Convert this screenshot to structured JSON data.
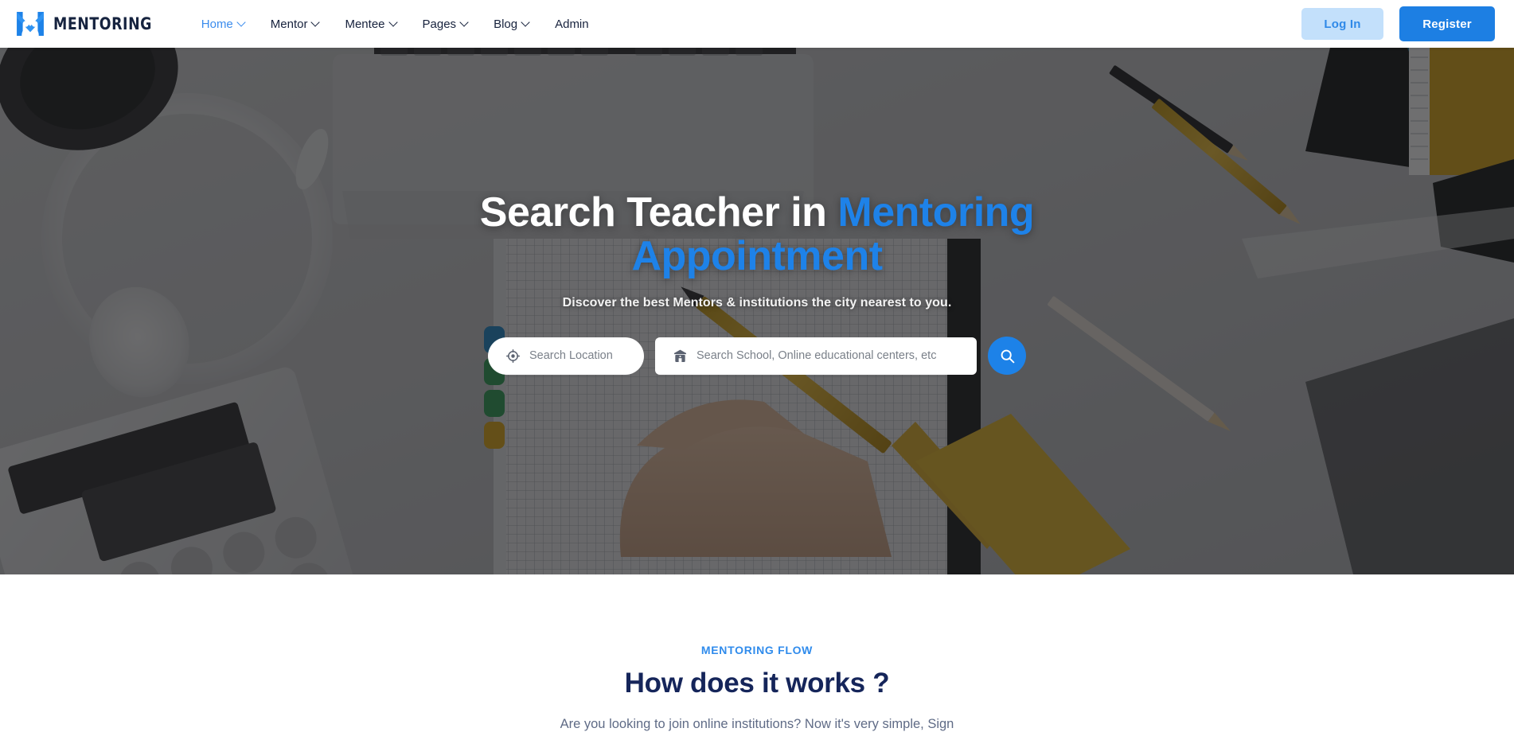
{
  "brand": {
    "name": "MENTORING",
    "logo_icon": "mentoring-m-people-logo",
    "accent_color": "#1d82e8",
    "text_color": "#16233f"
  },
  "nav": {
    "items": [
      {
        "label": "Home",
        "has_dropdown": true,
        "active": true
      },
      {
        "label": "Mentor",
        "has_dropdown": true,
        "active": false
      },
      {
        "label": "Mentee",
        "has_dropdown": true,
        "active": false
      },
      {
        "label": "Pages",
        "has_dropdown": true,
        "active": false
      },
      {
        "label": "Blog",
        "has_dropdown": true,
        "active": false
      },
      {
        "label": "Admin",
        "has_dropdown": false,
        "active": false
      }
    ],
    "login_label": "Log In",
    "register_label": "Register",
    "login_bg": "#c3e0fb",
    "login_fg": "#2f89e8",
    "register_bg": "#1d7fe3",
    "register_fg": "#ffffff"
  },
  "hero": {
    "title_part1": "Search Teacher in ",
    "title_accent": "Mentoring Appointment",
    "subtitle": "Discover the best Mentors & institutions the city nearest to you.",
    "location_placeholder": "Search Location",
    "location_value": "",
    "location_icon": "location-crosshair-icon",
    "school_placeholder": "Search School, Online educational centers, etc",
    "school_value": "",
    "school_icon": "school-building-icon",
    "search_button_icon": "search-icon",
    "search_button_color": "#1d82e8"
  },
  "flow": {
    "eyebrow": "MENTORING FLOW",
    "title": "How does it works ?",
    "description": "Are you looking to join online institutions? Now it's very simple, Sign",
    "eyebrow_color": "#2f8bec",
    "title_color": "#15255a"
  }
}
